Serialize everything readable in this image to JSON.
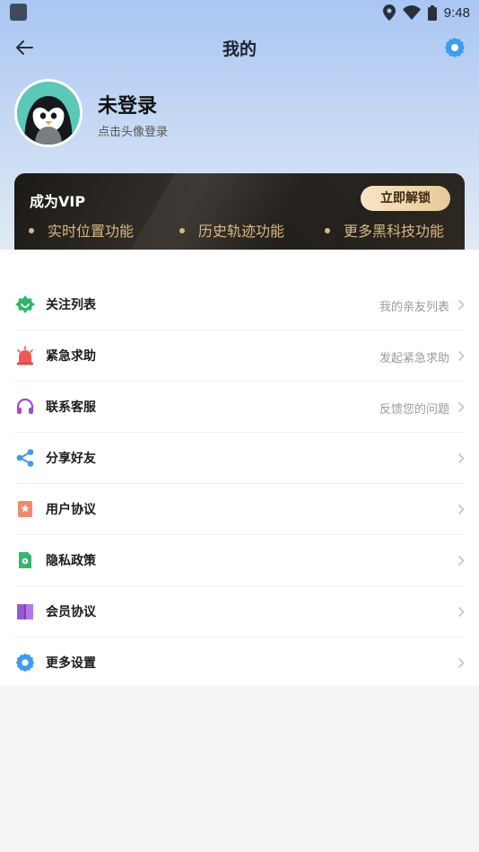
{
  "status_bar": {
    "time": "9:48",
    "icons": [
      "app-notification-icon",
      "location-icon",
      "wifi-icon",
      "battery-icon"
    ]
  },
  "header": {
    "title": "我的",
    "back_icon": "back-arrow-icon",
    "settings_icon": "gear-icon"
  },
  "profile": {
    "name": "未登录",
    "hint": "点击头像登录"
  },
  "vip": {
    "title": "成为VIP",
    "button_label": "立即解锁",
    "features": [
      "实时位置功能",
      "历史轨迹功能",
      "更多黑科技功能"
    ]
  },
  "menu": {
    "items": [
      {
        "label": "关注列表",
        "sub": "我的亲友列表",
        "icon": "star-badge-icon"
      },
      {
        "label": "紧急求助",
        "sub": "发起紧急求助",
        "icon": "alarm-icon"
      },
      {
        "label": "联系客服",
        "sub": "反馈您的问题",
        "icon": "headset-icon"
      },
      {
        "label": "分享好友",
        "sub": "",
        "icon": "share-icon"
      },
      {
        "label": "用户协议",
        "sub": "",
        "icon": "bookmark-star-icon"
      },
      {
        "label": "隐私政策",
        "sub": "",
        "icon": "document-gear-icon"
      },
      {
        "label": "会员协议",
        "sub": "",
        "icon": "book-icon"
      },
      {
        "label": "更多设置",
        "sub": "",
        "icon": "gear-icon"
      }
    ]
  },
  "colors": {
    "accent_blue": "#3d9bf0",
    "vip_gold": "#d8b883",
    "header_gradient_top": "#a9c6f3"
  }
}
